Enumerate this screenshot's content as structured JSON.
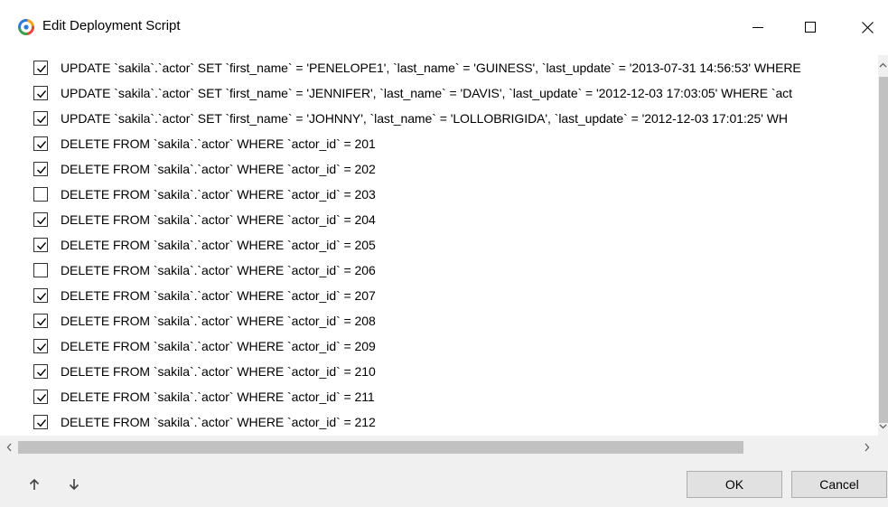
{
  "window": {
    "title": "Edit Deployment Script",
    "icons": {
      "app": "devart-app-icon",
      "minimize": "minimize-icon",
      "maximize": "maximize-icon",
      "close": "close-icon"
    }
  },
  "script_rows": [
    {
      "checked": true,
      "text": "UPDATE `sakila`.`actor` SET `first_name` = 'PENELOPE1', `last_name` = 'GUINESS', `last_update` = '2013-07-31 14:56:53' WHERE"
    },
    {
      "checked": true,
      "text": "UPDATE `sakila`.`actor` SET `first_name` = 'JENNIFER', `last_name` = 'DAVIS', `last_update` = '2012-12-03 17:03:05' WHERE `act"
    },
    {
      "checked": true,
      "text": "UPDATE `sakila`.`actor` SET `first_name` = 'JOHNNY', `last_name` = 'LOLLOBRIGIDA', `last_update` = '2012-12-03 17:01:25' WH"
    },
    {
      "checked": true,
      "text": "DELETE FROM `sakila`.`actor` WHERE `actor_id` = 201"
    },
    {
      "checked": true,
      "text": "DELETE FROM `sakila`.`actor` WHERE `actor_id` = 202"
    },
    {
      "checked": false,
      "text": "DELETE FROM `sakila`.`actor` WHERE `actor_id` = 203"
    },
    {
      "checked": true,
      "text": "DELETE FROM `sakila`.`actor` WHERE `actor_id` = 204"
    },
    {
      "checked": true,
      "text": "DELETE FROM `sakila`.`actor` WHERE `actor_id` = 205"
    },
    {
      "checked": false,
      "text": "DELETE FROM `sakila`.`actor` WHERE `actor_id` = 206"
    },
    {
      "checked": true,
      "text": "DELETE FROM `sakila`.`actor` WHERE `actor_id` = 207"
    },
    {
      "checked": true,
      "text": "DELETE FROM `sakila`.`actor` WHERE `actor_id` = 208"
    },
    {
      "checked": true,
      "text": "DELETE FROM `sakila`.`actor` WHERE `actor_id` = 209"
    },
    {
      "checked": true,
      "text": "DELETE FROM `sakila`.`actor` WHERE `actor_id` = 210"
    },
    {
      "checked": true,
      "text": "DELETE FROM `sakila`.`actor` WHERE `actor_id` = 211"
    },
    {
      "checked": true,
      "text": "DELETE FROM `sakila`.`actor` WHERE `actor_id` = 212"
    }
  ],
  "scrollbars": {
    "icons": {
      "up": "scroll-up-arrow-icon",
      "down": "scroll-down-arrow-icon",
      "left": "scroll-left-arrow-icon",
      "right": "scroll-right-arrow-icon"
    }
  },
  "footer": {
    "move_up_icon": "arrow-up-icon",
    "move_down_icon": "arrow-down-icon",
    "ok_label": "OK",
    "cancel_label": "Cancel"
  },
  "colors": {
    "footer_background": "#f0f0f0",
    "button_background": "#e1e1e1",
    "scroll_thumb": "#c1c1c1"
  }
}
